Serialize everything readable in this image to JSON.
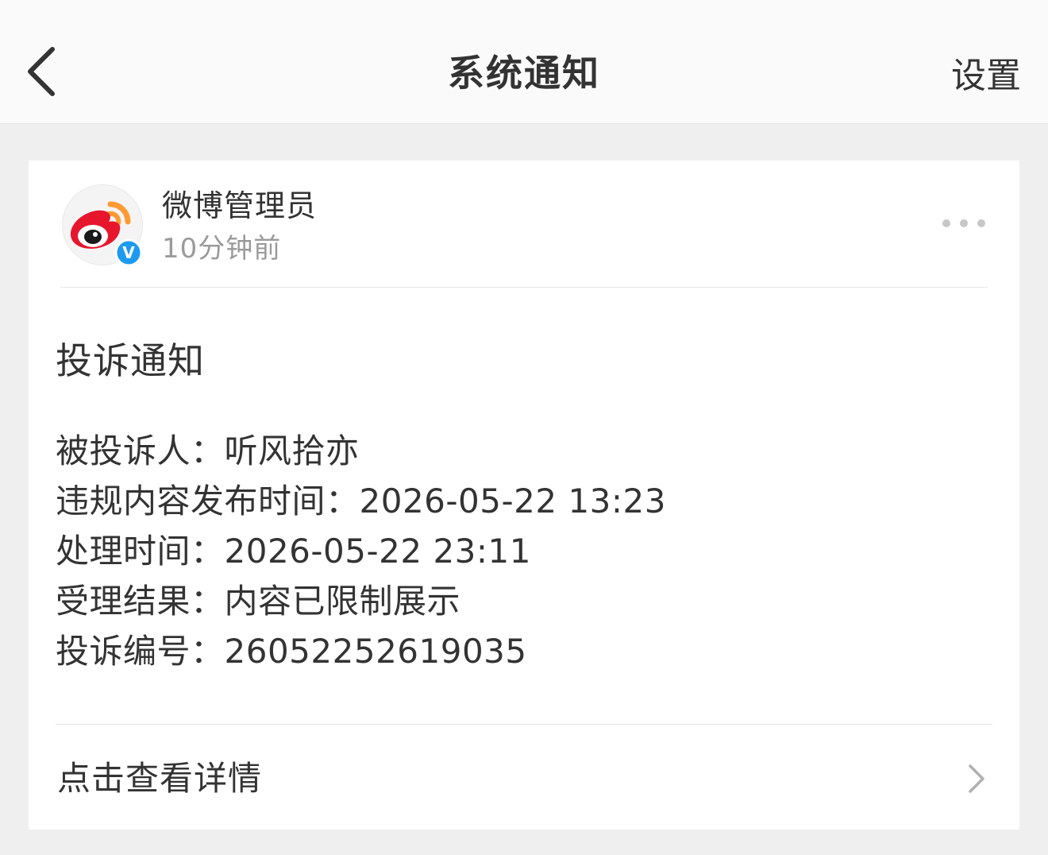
{
  "nav": {
    "back_icon": "chevron-left-icon",
    "title": "系统通知",
    "settings_label": "设置"
  },
  "message": {
    "sender": {
      "name": "微博管理员",
      "time": "10分钟前",
      "avatar_icon": "weibo-logo-icon",
      "verified_icon": "verified-badge-icon",
      "verified_mark": "V"
    },
    "more_icon": "more-dots-icon",
    "title": "投诉通知",
    "details": [
      {
        "label": "被投诉人：",
        "value": "听风拾亦"
      },
      {
        "label": "违规内容发布时间：",
        "value": "2026-05-22 13:23"
      },
      {
        "label": "处理时间：",
        "value": "2026-05-22 23:11"
      },
      {
        "label": "受理结果：",
        "value": "内容已限制展示"
      },
      {
        "label": "投诉编号：",
        "value": "26052252619035"
      }
    ],
    "view_detail_label": "点击查看详情",
    "view_detail_icon": "chevron-right-icon"
  },
  "colors": {
    "weibo_red": "#e6162d",
    "weibo_orange": "#ff9933",
    "verified_blue": "#1d9bf0",
    "text_primary": "#333333",
    "text_secondary": "#9a9a9a"
  }
}
